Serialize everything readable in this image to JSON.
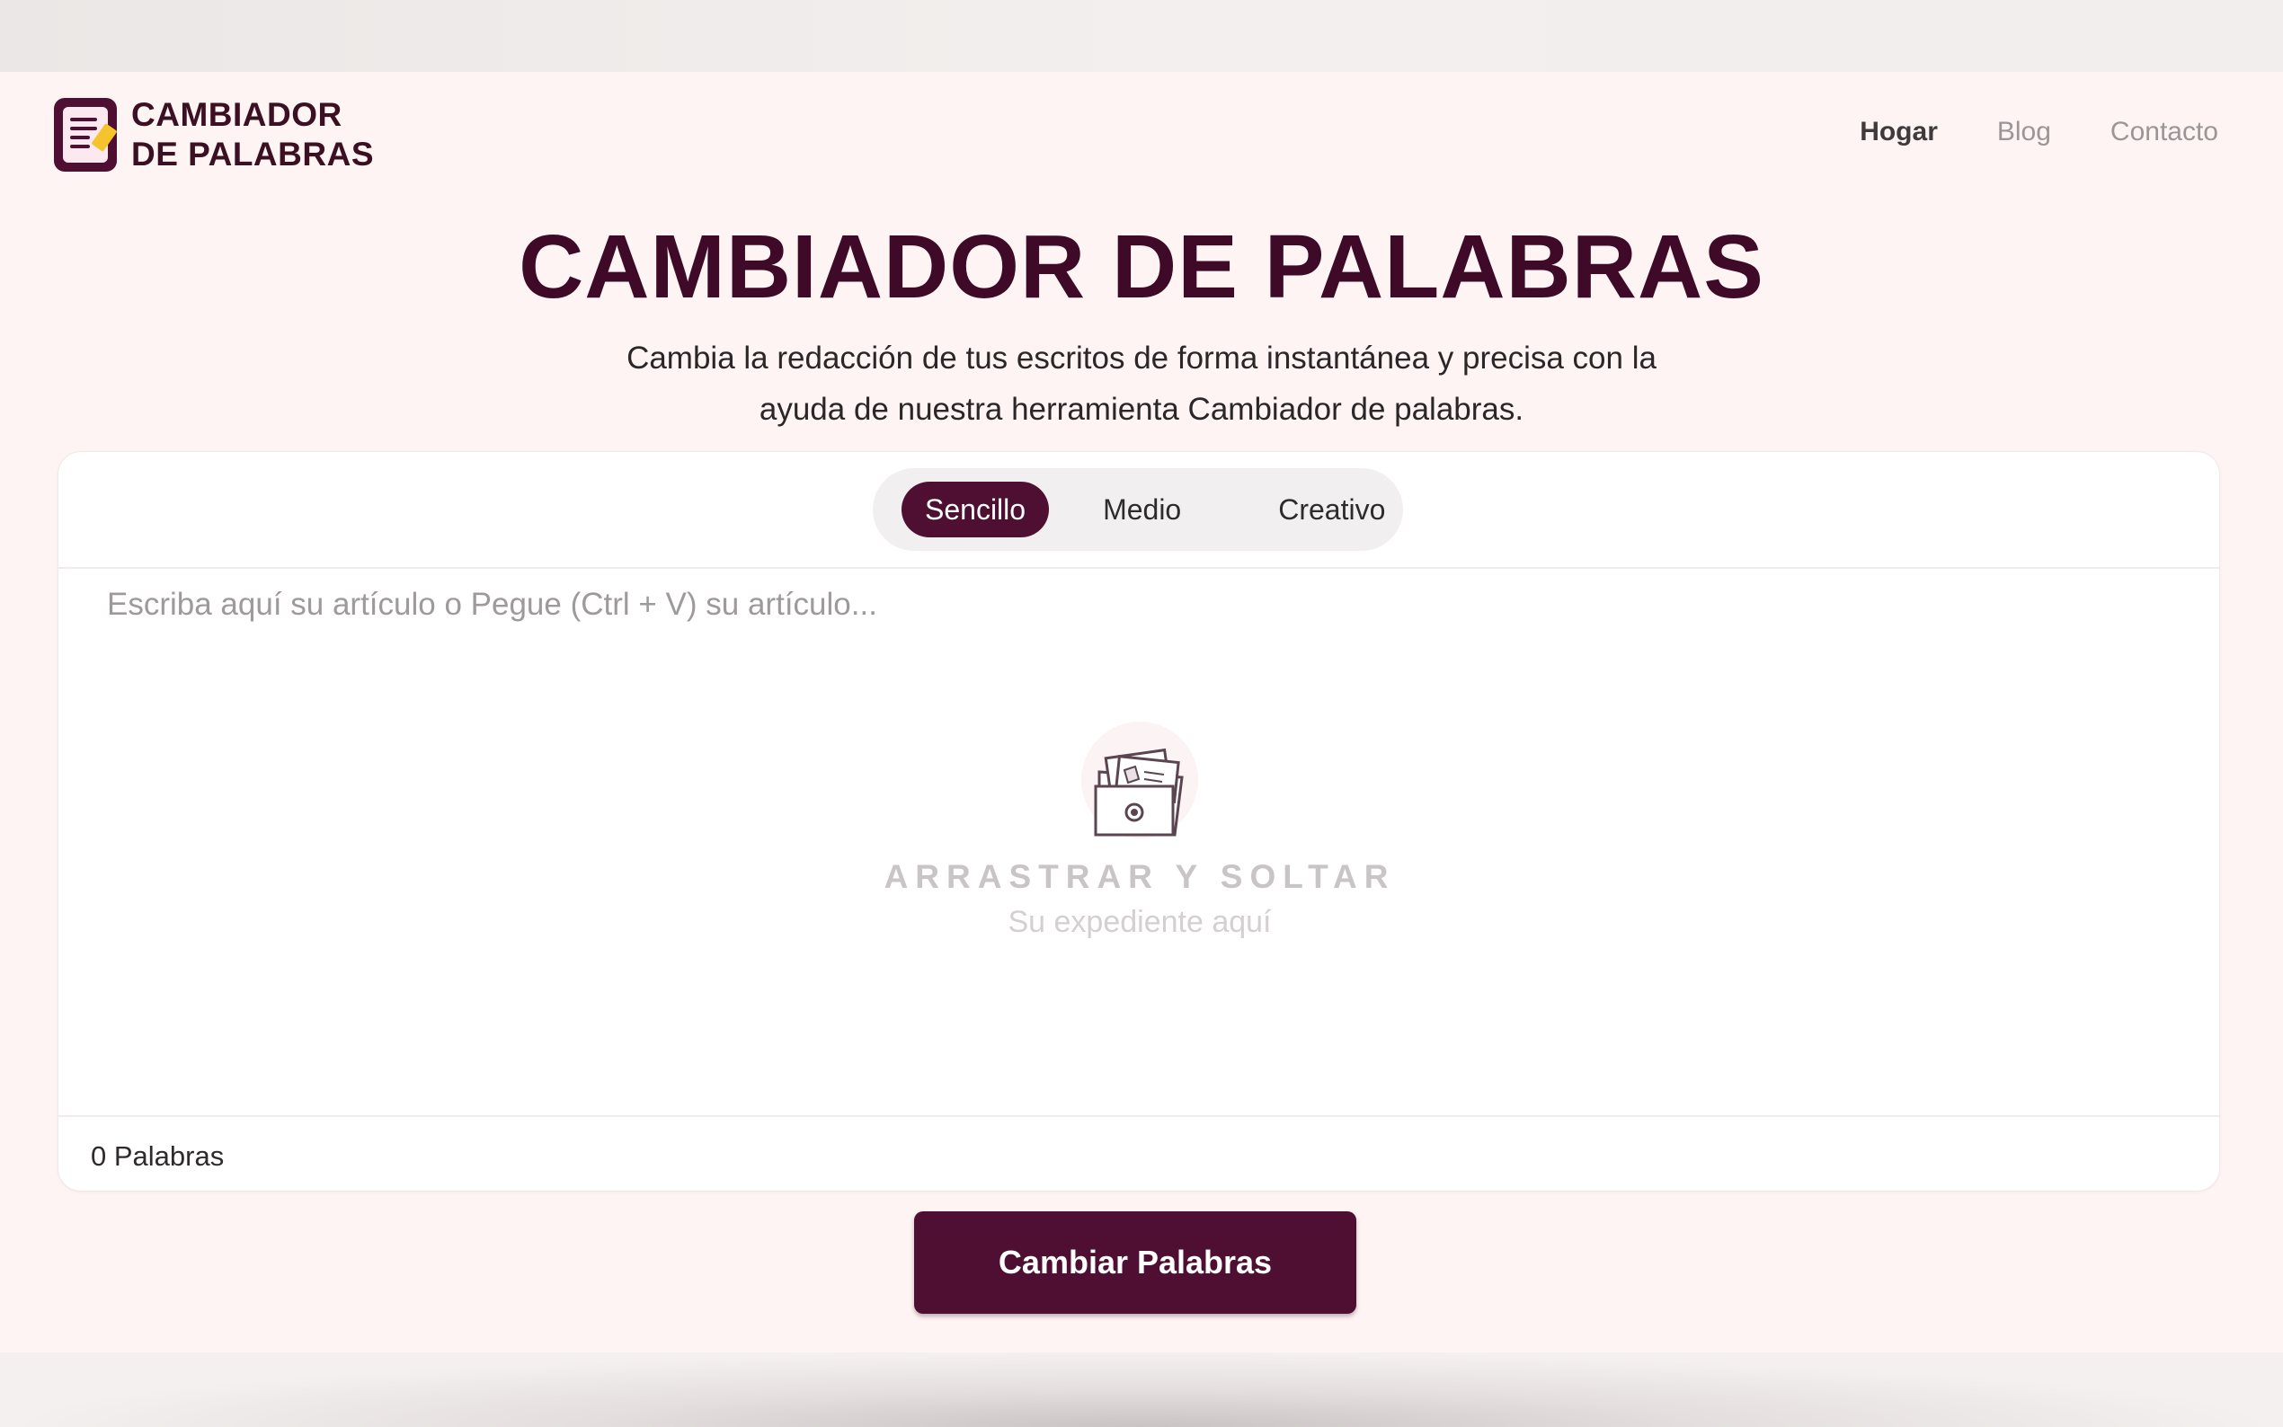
{
  "header": {
    "logo_line1": "CAMBIADOR",
    "logo_line2": "DE PALABRAS",
    "nav": [
      {
        "label": "Hogar",
        "active": true
      },
      {
        "label": "Blog",
        "active": false
      },
      {
        "label": "Contacto",
        "active": false
      }
    ]
  },
  "hero": {
    "title": "CAMBIADOR DE PALABRAS",
    "subtitle": "Cambia la redacción de tus escritos de forma instantánea y precisa con la ayuda de nuestra herramienta Cambiador de palabras."
  },
  "editor": {
    "modes": [
      "Sencillo",
      "Medio",
      "Creativo"
    ],
    "selected_mode": "Sencillo",
    "placeholder": "Escriba aquí su artículo o Pegue (Ctrl + V) su artículo...",
    "dropzone_title": "ARRASTRAR Y SOLTAR",
    "dropzone_subtitle": "Su expediente aquí",
    "word_count": "0 Palabras"
  },
  "action": {
    "label": "Cambiar Palabras"
  },
  "colors": {
    "brand": "#4e0f33",
    "background": "#fdf4f3",
    "logo_accent": "#f5c32c"
  },
  "icons": {
    "logo": "document-pencil-icon",
    "dropzone": "folder-upload-icon"
  }
}
